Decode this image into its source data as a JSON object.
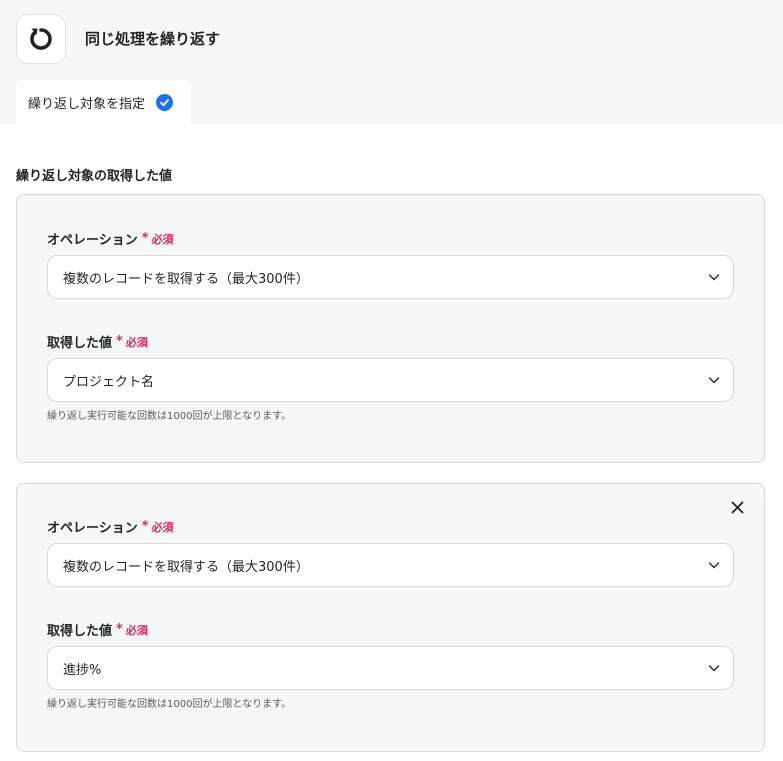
{
  "header": {
    "title": "同じ処理を繰り返す",
    "icon": "loop-icon"
  },
  "tabs": [
    {
      "label": "繰り返し対象を指定",
      "status_icon": "check-circle-icon",
      "active": true
    }
  ],
  "section": {
    "label": "繰り返し対象の取得した値"
  },
  "cards": [
    {
      "operation": {
        "label": "オペレーション",
        "required_mark": "*",
        "required_text": "必須",
        "value": "複数のレコードを取得する（最大300件）"
      },
      "value_field": {
        "label": "取得した値",
        "required_mark": "*",
        "required_text": "必須",
        "value": "プロジェクト名"
      },
      "hint": "繰り返し実行可能な回数は1000回が上限となります。",
      "removable": false
    },
    {
      "operation": {
        "label": "オペレーション",
        "required_mark": "*",
        "required_text": "必須",
        "value": "複数のレコードを取得する（最大300件）"
      },
      "value_field": {
        "label": "取得した値",
        "required_mark": "*",
        "required_text": "必須",
        "value": "進捗%"
      },
      "hint": "繰り返し実行可能な回数は1000回が上限となります。",
      "removable": true
    }
  ],
  "colors": {
    "accent": "#1a73e8",
    "required": "#e0245e",
    "card_bg": "#f6f7f9",
    "border": "#d3d7de"
  }
}
